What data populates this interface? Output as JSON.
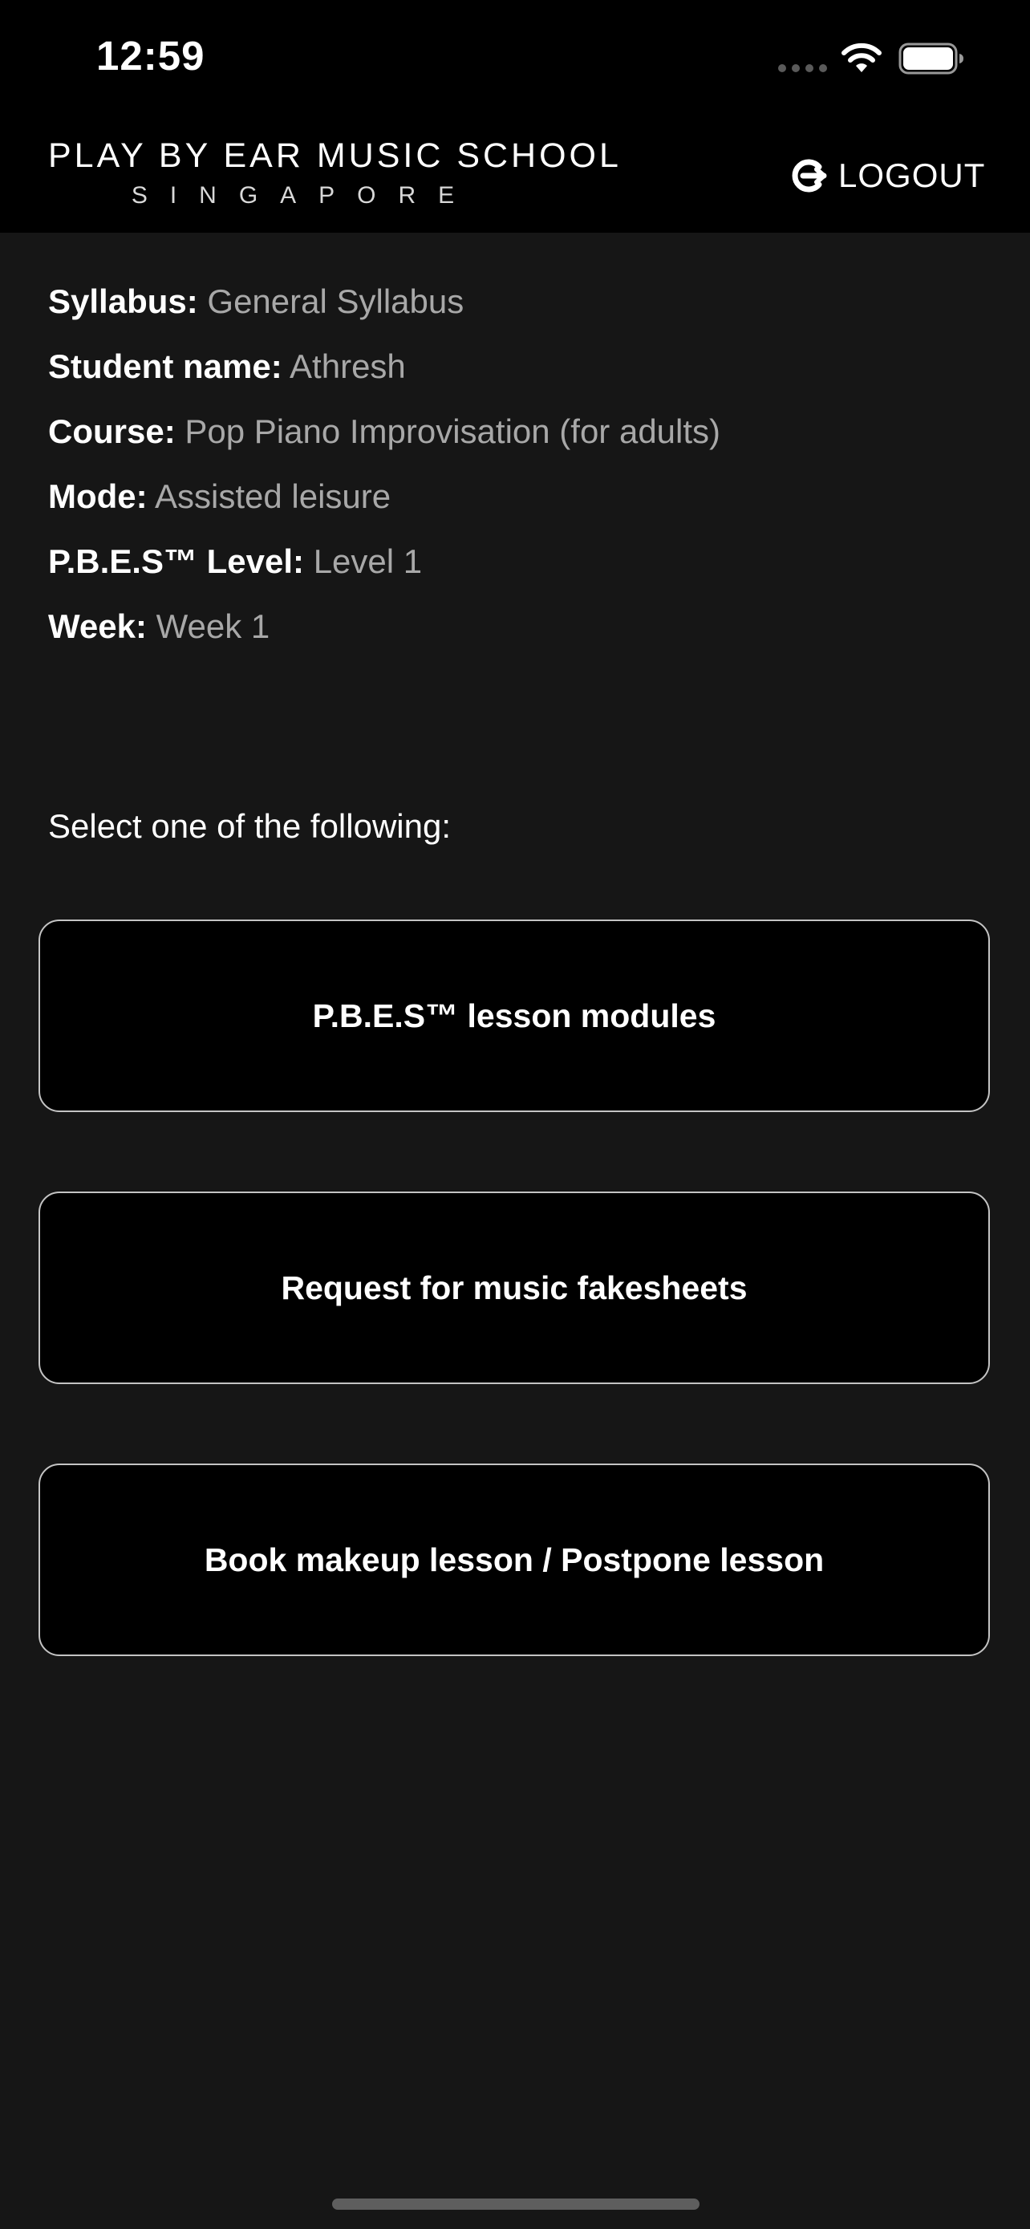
{
  "status_bar": {
    "time": "12:59",
    "icons": [
      "cellular-signal-icon",
      "wifi-icon",
      "battery-icon"
    ]
  },
  "header": {
    "logo_line1": "PLAY BY EAR MUSIC SCHOOL",
    "logo_line2": "SINGAPORE",
    "logout_label": "LOGOUT",
    "logout_icon": "logout-icon"
  },
  "student_info": [
    {
      "label": "Syllabus:",
      "value": "General Syllabus"
    },
    {
      "label": "Student name:",
      "value": "Athresh"
    },
    {
      "label": "Course:",
      "value": "Pop Piano Improvisation (for adults)"
    },
    {
      "label": "Mode:",
      "value": "Assisted leisure"
    },
    {
      "label": "P.B.E.S™ Level:",
      "value": "Level 1"
    },
    {
      "label": "Week:",
      "value": "Week 1"
    }
  ],
  "prompt": "Select one of the following:",
  "actions": [
    {
      "label": "P.B.E.S™ lesson modules"
    },
    {
      "label": "Request for music fakesheets"
    },
    {
      "label": "Book makeup lesson / Postpone lesson"
    }
  ],
  "colors": {
    "background": "#161616",
    "header_background": "#000000",
    "label_text": "#ffffff",
    "value_text": "#a8a8a8",
    "button_border": "#c4c4c4"
  }
}
